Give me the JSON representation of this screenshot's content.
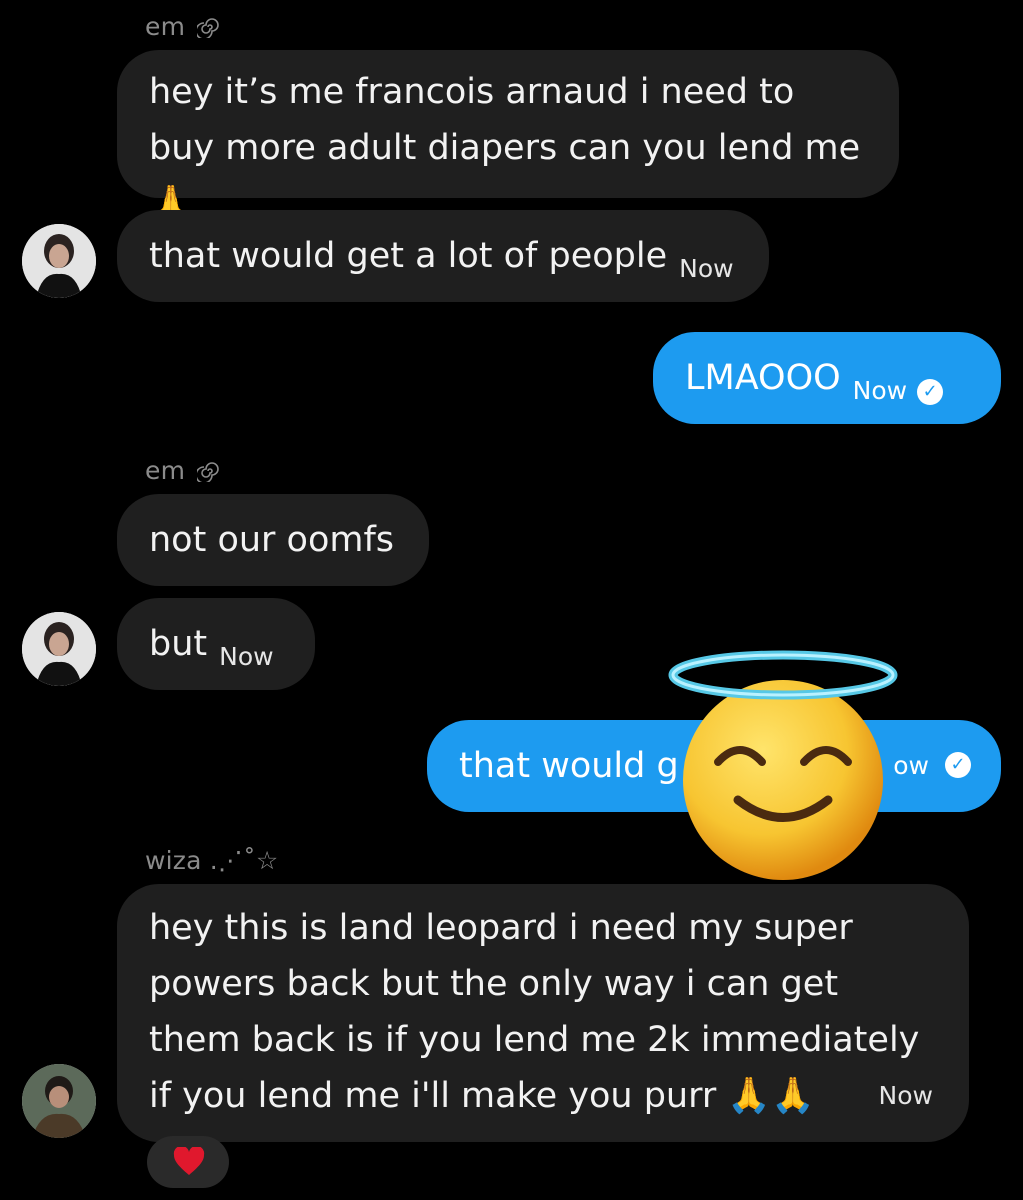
{
  "messages": [
    {
      "sender": "em",
      "sender_icon": "spiral-icon",
      "text": "hey it’s me francois arnaud i need to buy more adult diapers can you lend me 🙏"
    },
    {
      "text": "that would get a lot of people",
      "time": "Now"
    },
    {
      "text": "LMAOOO",
      "time": "Now",
      "status": "read-check-icon"
    },
    {
      "sender": "em",
      "sender_icon": "spiral-icon",
      "text": "not our oomfs"
    },
    {
      "text": "but",
      "time": "Now"
    },
    {
      "text_visible": "that would g",
      "time_partial": "ow",
      "status": "read-check-icon",
      "overlay": "smiling-face-with-halo-emoji"
    },
    {
      "sender": "wiza .⋰˚☆",
      "text": "hey this is land leopard i need my super powers back but the only way i can get them back is if you lend me 2k immediately if you lend me i'll make you purr 🙏🙏",
      "time": "Now",
      "reaction": "❤️"
    }
  ],
  "colors": {
    "background": "#000000",
    "incoming_bubble": "#1f1f1f",
    "outgoing_bubble": "#1d9bf0",
    "sender_text": "#8b8b8b"
  }
}
